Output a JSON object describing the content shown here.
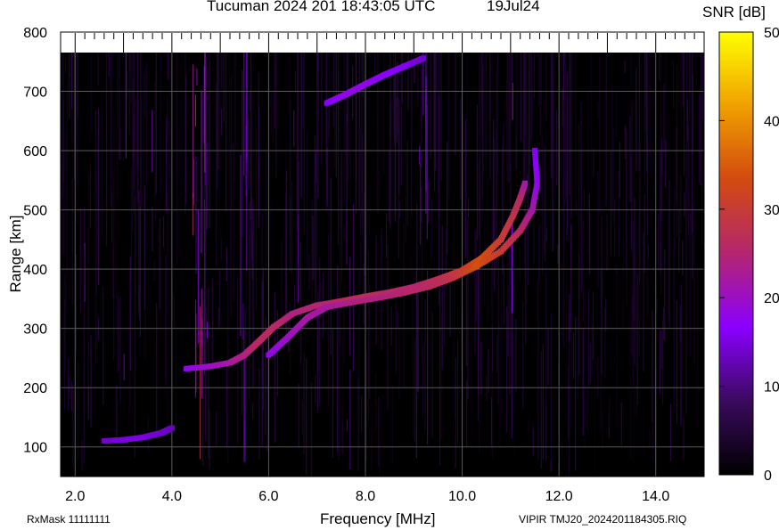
{
  "chart_data": {
    "type": "heatmap",
    "title": "Tucuman 2024 201 18:43:05 UTC",
    "date_label": "19Jul24",
    "xlabel": "Frequency [MHz]",
    "ylabel": "Range [km]",
    "colorbar_label": "SNR [dB]",
    "xlim": [
      1.7,
      15.0
    ],
    "ylim": [
      50,
      800
    ],
    "x_ticks": [
      "2.0",
      "4.0",
      "6.0",
      "8.0",
      "10.0",
      "12.0",
      "14.0"
    ],
    "x_tick_values": [
      2,
      4,
      6,
      8,
      10,
      12,
      14
    ],
    "y_ticks": [
      "100",
      "200",
      "300",
      "400",
      "500",
      "600",
      "700",
      "800"
    ],
    "y_tick_values": [
      100,
      200,
      300,
      400,
      500,
      600,
      700,
      800
    ],
    "colorbar_ticks": [
      "0",
      "10",
      "20",
      "30",
      "40",
      "50"
    ],
    "colorbar_tick_values": [
      0,
      10,
      20,
      30,
      40,
      50
    ],
    "colorbar_range": [
      0,
      50
    ],
    "grid": true,
    "colormap": [
      "#000000",
      "#3a0a5e",
      "#8b00ff",
      "#b4266e",
      "#d24a10",
      "#f0a000",
      "#ffff00"
    ],
    "traces": [
      {
        "name": "ordinary",
        "points": [
          [
            4.3,
            232
          ],
          [
            4.8,
            236
          ],
          [
            5.2,
            242
          ],
          [
            5.5,
            255
          ],
          [
            5.8,
            278
          ],
          [
            6.1,
            302
          ],
          [
            6.5,
            325
          ],
          [
            7.0,
            339
          ],
          [
            7.5,
            346
          ],
          [
            8.0,
            354
          ],
          [
            8.5,
            361
          ],
          [
            9.0,
            370
          ],
          [
            9.5,
            383
          ],
          [
            10.0,
            398
          ],
          [
            10.4,
            418
          ],
          [
            10.8,
            450
          ],
          [
            11.05,
            490
          ],
          [
            11.2,
            520
          ],
          [
            11.3,
            545
          ]
        ],
        "snr": [
          18,
          20,
          22,
          24,
          26,
          26,
          24,
          25,
          26,
          27,
          26,
          25,
          27,
          30,
          34,
          30,
          28,
          26,
          22
        ]
      },
      {
        "name": "extraordinary",
        "points": [
          [
            6.0,
            255
          ],
          [
            6.4,
            285
          ],
          [
            6.8,
            318
          ],
          [
            7.2,
            336
          ],
          [
            7.8,
            345
          ],
          [
            8.3,
            352
          ],
          [
            8.8,
            360
          ],
          [
            9.3,
            370
          ],
          [
            9.8,
            385
          ],
          [
            10.3,
            405
          ],
          [
            10.8,
            430
          ],
          [
            11.2,
            465
          ],
          [
            11.45,
            500
          ],
          [
            11.55,
            545
          ],
          [
            11.5,
            600
          ]
        ],
        "snr": [
          18,
          20,
          22,
          22,
          24,
          24,
          25,
          26,
          28,
          34,
          30,
          26,
          22,
          18,
          16
        ]
      },
      {
        "name": "low_trace",
        "points": [
          [
            2.6,
            110
          ],
          [
            3.0,
            112
          ],
          [
            3.4,
            116
          ],
          [
            3.8,
            124
          ],
          [
            4.0,
            132
          ]
        ],
        "snr": [
          14,
          15,
          15,
          14,
          13
        ]
      },
      {
        "name": "multihop_trace",
        "points": [
          [
            7.2,
            680
          ],
          [
            7.6,
            695
          ],
          [
            8.0,
            712
          ],
          [
            8.4,
            728
          ],
          [
            8.8,
            742
          ],
          [
            9.2,
            756
          ]
        ],
        "snr": [
          16,
          18,
          18,
          17,
          16,
          14
        ]
      }
    ]
  },
  "footer": {
    "rx_mask": "RxMask 11111111",
    "source": "VIPIR  TMJ20_2024201184305.RIQ"
  }
}
